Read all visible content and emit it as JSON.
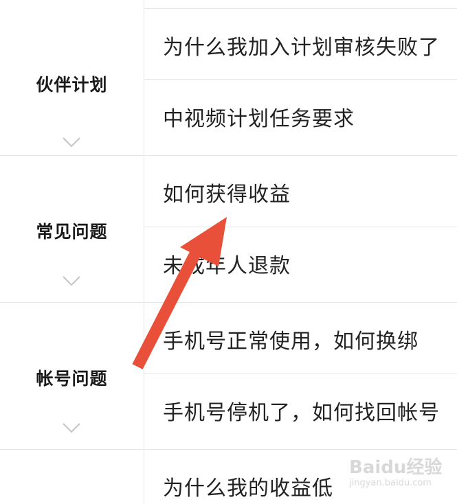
{
  "categories": [
    {
      "label": "伙伴计划",
      "icon": "chevron-down-icon"
    },
    {
      "label": "常见问题",
      "icon": "chevron-down-icon"
    },
    {
      "label": "帐号问题",
      "icon": "chevron-down-icon"
    }
  ],
  "questions": [
    "为什么我加入计划审核失败了",
    "中视频计划任务要求",
    "如何获得收益",
    "未成年人退款",
    "手机号正常使用，如何换绑",
    "手机号停机了，如何找回帐号",
    "为什么我的收益低"
  ],
  "annotation": {
    "type": "red-arrow",
    "color": "#e8503a"
  },
  "watermark": {
    "brand": "Baidu经验",
    "sub": "jingyan.baidu.com"
  },
  "colors": {
    "divider": "#e6e6e6",
    "chevron": "#c4c4c4",
    "text": "#222222"
  }
}
